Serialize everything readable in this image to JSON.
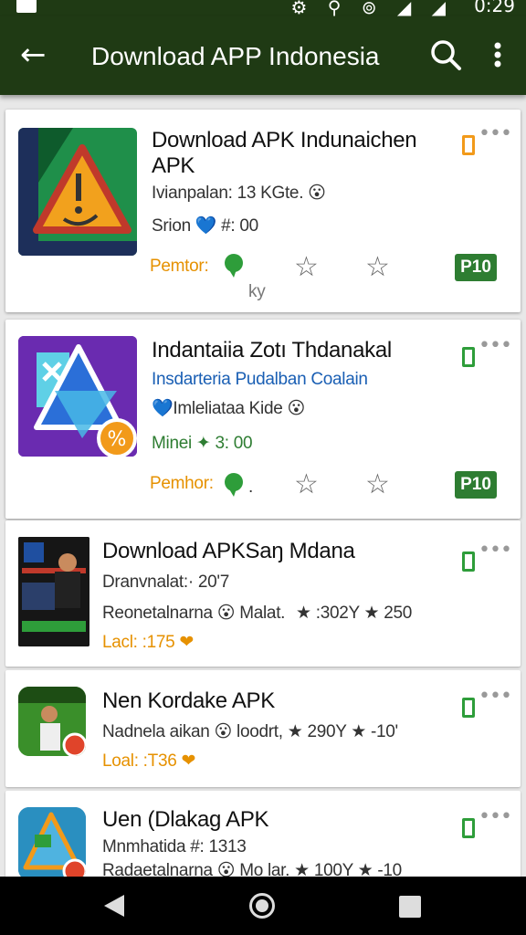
{
  "status_bar": {
    "icons": "⚙ ⚲ ⊚ ◢ ◢",
    "clock": "0:29"
  },
  "app_bar": {
    "title": "Download APP Indonesia",
    "back_glyph": "←"
  },
  "cards": [
    {
      "title_line1": "Download APK Indunaichen",
      "title_line2": "APK",
      "line2": "Ivianpalan: 13 KGte. 😮",
      "line3": "Srion 💙 #: 00",
      "label": "Pemtor:",
      "extra": "ky",
      "badge": "P10"
    },
    {
      "title_line1": "Indantaiia Zotı Thdanakal",
      "line2": "Insdarteria Pudalban Coalain",
      "line3": "💙Imleliataa Kide 😮",
      "line4": "Minei ✦ 3: 00",
      "label": "Pemhor:",
      "extra": ".",
      "badge": "P10"
    },
    {
      "title_line1": "Download APKSaŋ Mdana",
      "line2": "Dranvnalat:· 20'7",
      "line3_a": "Reonetalnarna 😮 Malat.",
      "line3_b": "★ :302Y ★ 250",
      "line4": "Lacl: :175 ❤"
    },
    {
      "title_line1": "Nen Kordake APK",
      "line2": "Nadnela aikan 😮 loodrt, ★ 290Y ★ -10'",
      "line3": "Loal: :T36 ❤"
    },
    {
      "title_line1": "Uen (Dlakag APK",
      "line2": "Mnmhatida #: 1313",
      "line3": "Radaetalnarna 😮 Mo lar. ★ 100Y ★ -10"
    }
  ]
}
